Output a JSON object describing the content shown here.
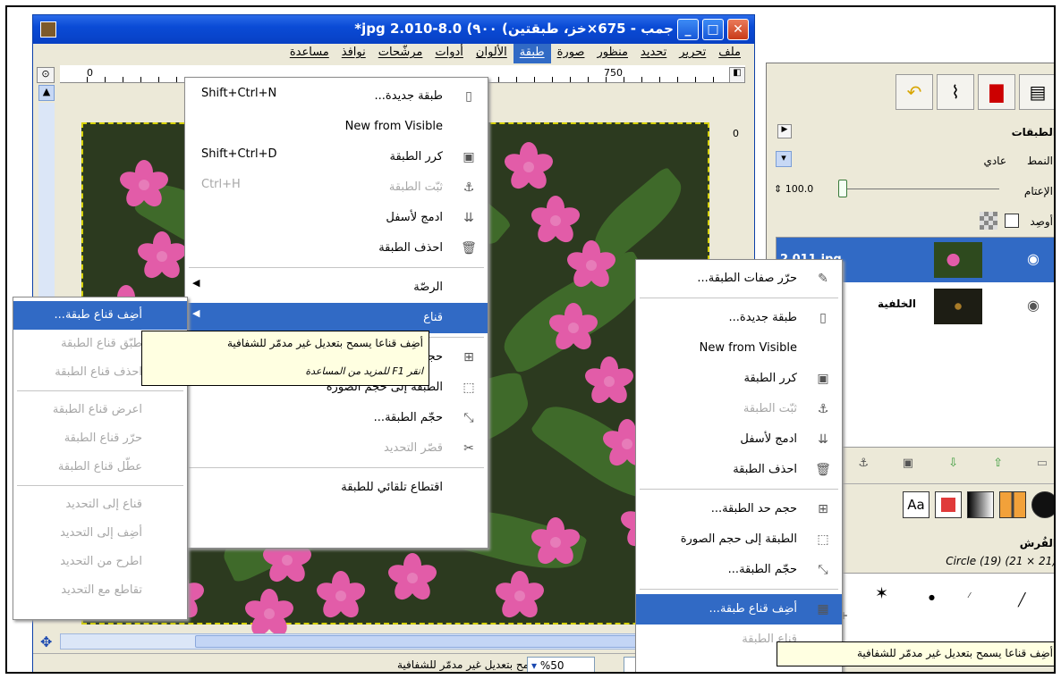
{
  "window": {
    "title": "جمب - 675×خز، طبقتين) ٩٠٠) 8.0-010.jpg 2*",
    "menubar": [
      "ملف",
      "تحرير",
      "تحديد",
      "منظور",
      "صورة",
      "طبقة",
      "الألوان",
      "أدوات",
      "مرشّحات",
      "نوافذ",
      "مساعدة"
    ],
    "active_menu": "طبقة",
    "ruler_marks": [
      "0",
      "750",
      "0"
    ],
    "status_zoom": "%50",
    "status_text": "أضِف قناعا يسمح بتعديل غير مدمّر للشفافية"
  },
  "layer_menu": {
    "items": [
      {
        "label": "طبقة جديدة...",
        "shortcut": "Shift+Ctrl+N",
        "icon": "page-icon",
        "disabled": false
      },
      {
        "label": "New from Visible",
        "shortcut": "",
        "icon": "",
        "disabled": false
      },
      {
        "label": "كرر الطبقة",
        "shortcut": "Shift+Ctrl+D",
        "icon": "duplicate-icon",
        "disabled": false
      },
      {
        "label": "ثبّت الطبقة",
        "shortcut": "Ctrl+H",
        "icon": "anchor-icon",
        "disabled": true
      },
      {
        "label": "ادمج لأسفل",
        "shortcut": "",
        "icon": "merge-down-icon",
        "disabled": false
      },
      {
        "label": "احذف الطبقة",
        "shortcut": "",
        "icon": "trash-icon",
        "disabled": false
      },
      {
        "label": "الرصّة",
        "shortcut": "",
        "icon": "",
        "disabled": false,
        "submenu": true
      },
      {
        "label": "قناع",
        "shortcut": "",
        "icon": "",
        "disabled": false,
        "submenu": true,
        "highlighted": true
      },
      {
        "label": "حجم حد الطبقة...",
        "shortcut": "",
        "icon": "layer-boundary-icon",
        "disabled": false
      },
      {
        "label": "الطبقة إلى حجم الصورة",
        "shortcut": "",
        "icon": "layer-to-image-icon",
        "disabled": false
      },
      {
        "label": "حجّم الطبقة...",
        "shortcut": "",
        "icon": "scale-layer-icon",
        "disabled": false
      },
      {
        "label": "قصّر التحديد",
        "shortcut": "",
        "icon": "crop-icon",
        "disabled": true
      },
      {
        "label": "اقتطاع تلقائي للطبقة",
        "shortcut": "",
        "icon": "",
        "disabled": false
      }
    ],
    "tooltip": "أضِف قناعا يسمح بتعديل غير مدمّر للشفافية",
    "tooltip_help": "انقر F1 للمزيد من المساعدة"
  },
  "mask_submenu": {
    "items": [
      {
        "label": "أضِف قناع طبقة...",
        "disabled": false,
        "highlighted": true
      },
      {
        "label": "طبّق قناع الطبقة",
        "disabled": true
      },
      {
        "label": "احذف قناع الطبقة",
        "disabled": true
      },
      {
        "label": "اعرض قناع الطبقة",
        "disabled": true
      },
      {
        "label": "حرّر قناع الطبقة",
        "disabled": true
      },
      {
        "label": "عطّل قناع الطبقة",
        "disabled": true
      },
      {
        "label": "قناع إلى التحديد",
        "disabled": true
      },
      {
        "label": "أضِف إلى التحديد",
        "disabled": true
      },
      {
        "label": "اطرح من التحديد",
        "disabled": true
      },
      {
        "label": "تقاطع مع التحديد",
        "disabled": true
      }
    ]
  },
  "layers_panel": {
    "title": "الطبقات",
    "mode_label": "النمط:",
    "mode_value": "عادي",
    "opacity_label": "الإعتام:",
    "opacity_value": "100.0",
    "lock_label": "أوصِد:",
    "layers": [
      {
        "name": "2 011.jpg",
        "selected": true
      },
      {
        "name": "الخلفية",
        "selected": false
      }
    ],
    "brush_title": "الفُرش",
    "brush_name": "Circle (19) (21 × 21)",
    "font_sample": "Aa"
  },
  "context_menu": {
    "items": [
      {
        "label": "حرّر صفات الطبقة...",
        "icon": "edit-icon",
        "disabled": false
      },
      {
        "label": "طبقة جديدة...",
        "icon": "page-icon",
        "disabled": false
      },
      {
        "label": "New from Visible",
        "icon": "",
        "disabled": false
      },
      {
        "label": "كرر الطبقة",
        "icon": "duplicate-icon",
        "disabled": false
      },
      {
        "label": "ثبّت الطبقة",
        "icon": "anchor-icon",
        "disabled": true
      },
      {
        "label": "ادمج لأسفل",
        "icon": "merge-down-icon",
        "disabled": false
      },
      {
        "label": "احذف الطبقة",
        "icon": "trash-icon",
        "disabled": false
      },
      {
        "label": "حجم حد الطبقة...",
        "icon": "layer-boundary-icon",
        "disabled": false
      },
      {
        "label": "الطبقة إلى حجم الصورة",
        "icon": "layer-to-image-icon",
        "disabled": false
      },
      {
        "label": "حجّم الطبقة...",
        "icon": "scale-layer-icon",
        "disabled": false
      },
      {
        "label": "أضِف قناع طبقة...",
        "icon": "add-mask-icon",
        "disabled": false,
        "highlighted": true
      },
      {
        "label": "قناع الطبقة",
        "icon": "",
        "disabled": true
      }
    ],
    "tooltip": "أضِف قناعا يسمح بتعديل غير مدمّر للشفافية"
  }
}
